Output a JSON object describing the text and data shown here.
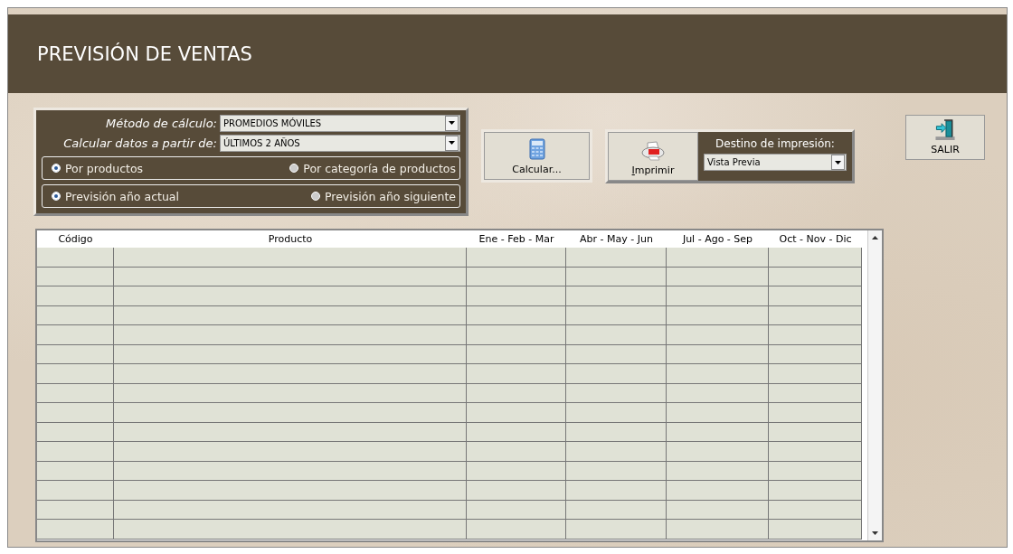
{
  "header": {
    "title": "PREVISIÓN DE VENTAS"
  },
  "options": {
    "fields": [
      {
        "label": "Método de cálculo:",
        "value": "PROMEDIOS MÓVILES"
      },
      {
        "label": "Calcular datos a partir de:",
        "value": "ÚLTIMOS 2 AÑOS"
      }
    ],
    "radio_groups": [
      [
        {
          "label": "Por productos",
          "selected": true
        },
        {
          "label": "Por categoría de productos",
          "selected": false
        }
      ],
      [
        {
          "label": "Previsión año actual",
          "selected": true
        },
        {
          "label": "Previsión año siguiente",
          "selected": false
        }
      ]
    ]
  },
  "calculate_button": {
    "label": "Calcular..."
  },
  "print": {
    "button": "Imprimir",
    "destination_label": "Destino de impresión:",
    "destination": "Vista Previa"
  },
  "exit_button": {
    "label": "SALIR"
  },
  "table": {
    "columns": [
      "Código",
      "Producto",
      "Ene - Feb - Mar",
      "Abr - May - Jun",
      "Jul - Ago - Sep",
      "Oct - Nov - Dic"
    ]
  }
}
